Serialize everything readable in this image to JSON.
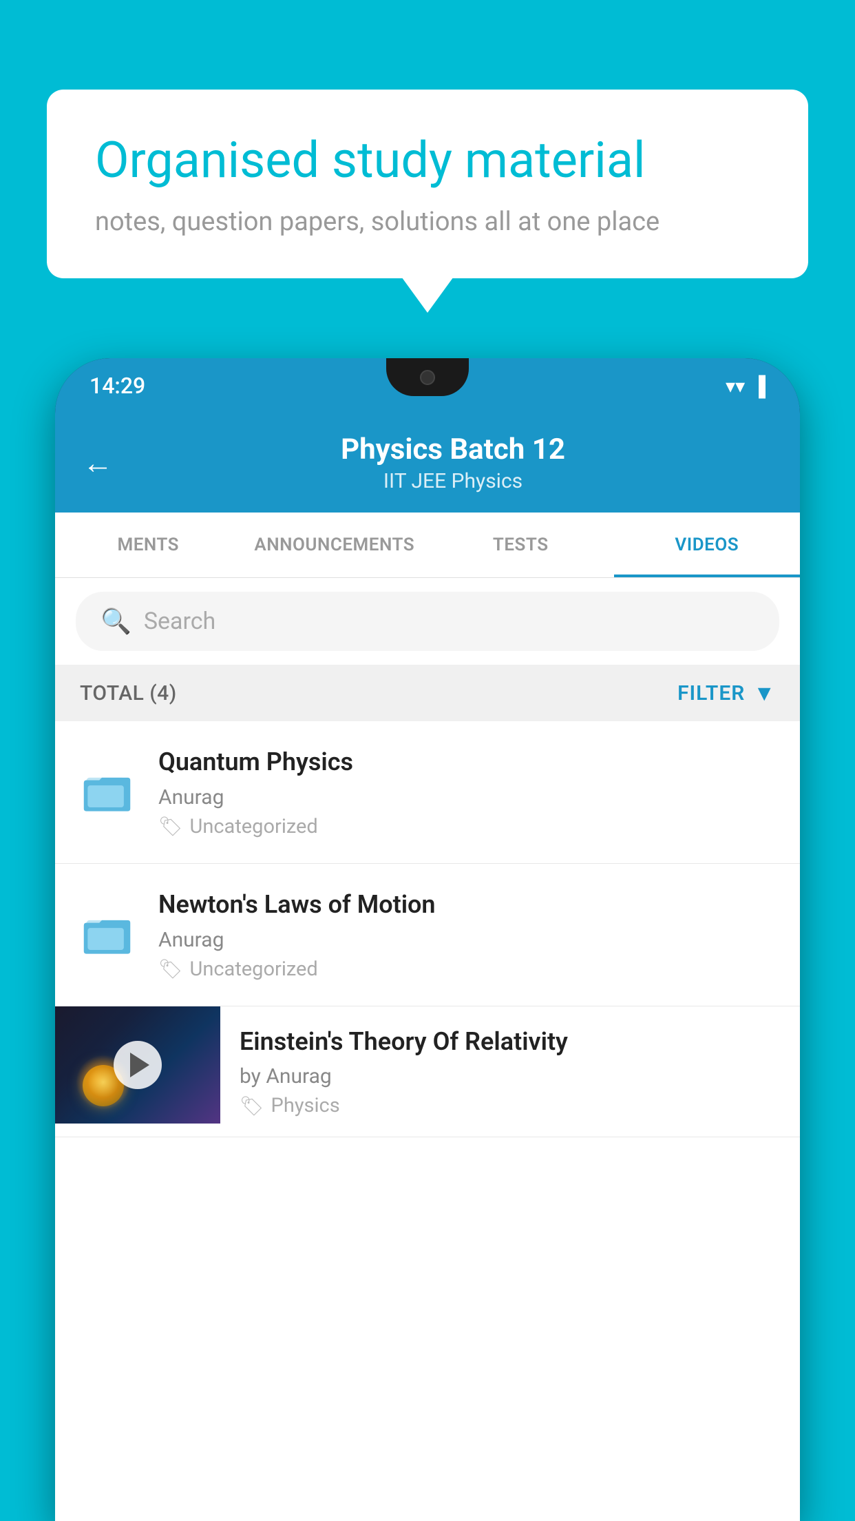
{
  "page": {
    "background_color": "#00bcd4"
  },
  "speech_bubble": {
    "title": "Organised study material",
    "subtitle": "notes, question papers, solutions all at one place"
  },
  "status_bar": {
    "time": "14:29",
    "wifi_icon": "▼",
    "signal_icon": "▲",
    "battery_icon": "▐"
  },
  "app_header": {
    "back_label": "←",
    "title": "Physics Batch 12",
    "subtitle": "IIT JEE   Physics"
  },
  "tabs": [
    {
      "id": "ments",
      "label": "MENTS",
      "active": false
    },
    {
      "id": "announcements",
      "label": "ANNOUNCEMENTS",
      "active": false
    },
    {
      "id": "tests",
      "label": "TESTS",
      "active": false
    },
    {
      "id": "videos",
      "label": "VIDEOS",
      "active": true
    }
  ],
  "search": {
    "placeholder": "Search"
  },
  "filter_bar": {
    "total_label": "TOTAL (4)",
    "filter_label": "FILTER"
  },
  "videos": [
    {
      "id": "v1",
      "title": "Quantum Physics",
      "author": "Anurag",
      "tag": "Uncategorized",
      "has_thumbnail": false
    },
    {
      "id": "v2",
      "title": "Newton's Laws of Motion",
      "author": "Anurag",
      "tag": "Uncategorized",
      "has_thumbnail": false
    },
    {
      "id": "v3",
      "title": "Einstein's Theory Of Relativity",
      "author": "by Anurag",
      "tag": "Physics",
      "has_thumbnail": true
    }
  ]
}
